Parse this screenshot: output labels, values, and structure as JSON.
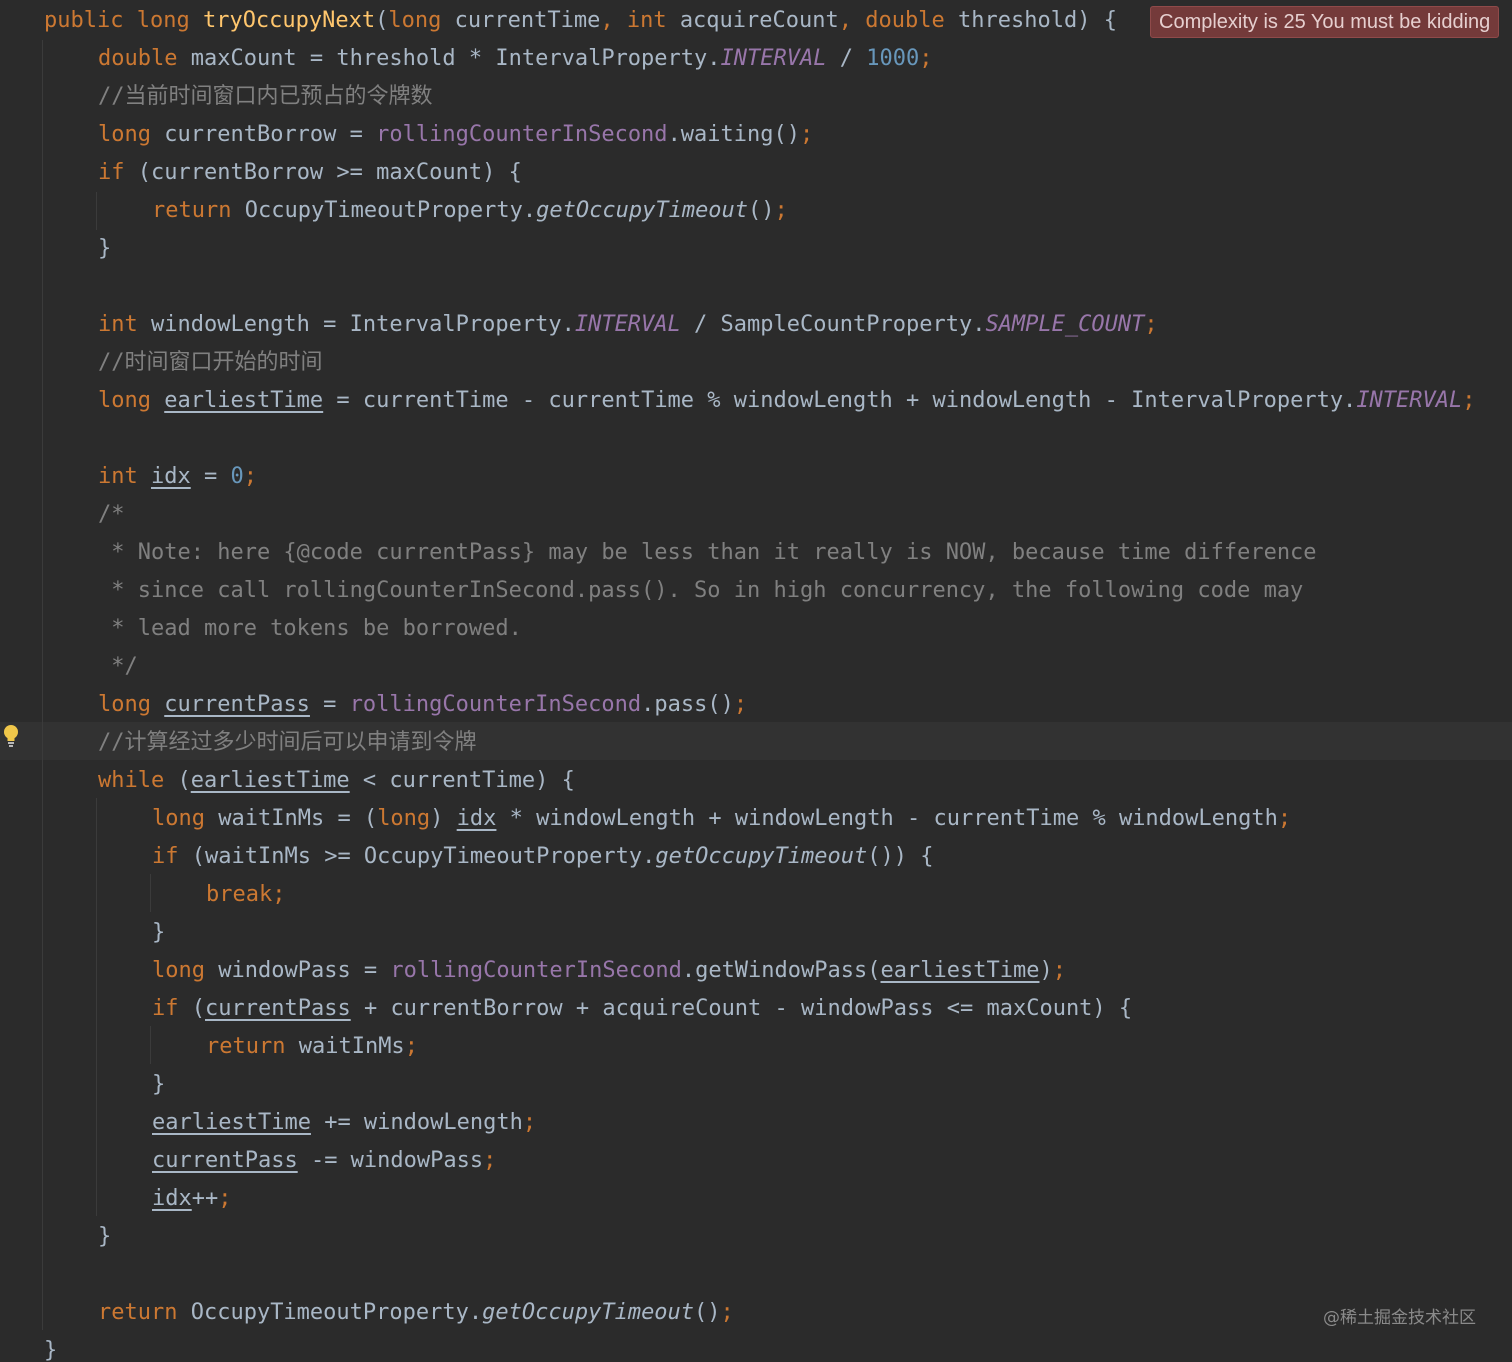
{
  "editor": {
    "complexity_badge": "Complexity is 25 You must be kidding",
    "watermark": "@稀土掘金技术社区",
    "lines": [
      [
        [
          "kw",
          "public "
        ],
        [
          "kw",
          "long "
        ],
        [
          "fn",
          "tryOccupyNext"
        ],
        [
          "op",
          "("
        ],
        [
          "kw",
          "long "
        ],
        [
          "id",
          "currentTime"
        ],
        [
          "pu",
          ", "
        ],
        [
          "kw",
          "int "
        ],
        [
          "id",
          "acquireCount"
        ],
        [
          "pu",
          ", "
        ],
        [
          "kw",
          "double "
        ],
        [
          "id",
          "threshold"
        ],
        [
          "op",
          ") {"
        ]
      ],
      [
        [
          "kw",
          "double "
        ],
        [
          "id",
          "maxCount = threshold * IntervalProperty."
        ],
        [
          "fldi",
          "INTERVAL"
        ],
        [
          "op",
          " / "
        ],
        [
          "num",
          "1000"
        ],
        [
          "pu",
          ";"
        ]
      ],
      [
        [
          "cmt",
          "//当前时间窗口内已预占的令牌数"
        ]
      ],
      [
        [
          "kw",
          "long "
        ],
        [
          "id",
          "currentBorrow = "
        ],
        [
          "fld",
          "rollingCounterInSecond"
        ],
        [
          "id",
          ".waiting()"
        ],
        [
          "pu",
          ";"
        ]
      ],
      [
        [
          "kw",
          "if "
        ],
        [
          "id",
          "(currentBorrow >= maxCount) {"
        ]
      ],
      [
        [
          "kw",
          "return "
        ],
        [
          "id",
          "OccupyTimeoutProperty."
        ],
        [
          "mi",
          "getOccupyTimeout"
        ],
        [
          "id",
          "()"
        ],
        [
          "pu",
          ";"
        ]
      ],
      [
        [
          "id",
          "}"
        ]
      ],
      [],
      [
        [
          "kw",
          "int "
        ],
        [
          "id",
          "windowLength = IntervalProperty."
        ],
        [
          "fldi",
          "INTERVAL"
        ],
        [
          "id",
          " / SampleCountProperty."
        ],
        [
          "fldi",
          "SAMPLE_COUNT"
        ],
        [
          "pu",
          ";"
        ]
      ],
      [
        [
          "cmt",
          "//时间窗口开始的时间"
        ]
      ],
      [
        [
          "kw",
          "long "
        ],
        [
          "ul",
          "earliestTime"
        ],
        [
          "id",
          " = currentTime - currentTime % windowLength + windowLength - IntervalProperty."
        ],
        [
          "fldi",
          "INTERVAL"
        ],
        [
          "pu",
          ";"
        ]
      ],
      [],
      [
        [
          "kw",
          "int "
        ],
        [
          "ul",
          "idx"
        ],
        [
          "id",
          " = "
        ],
        [
          "num",
          "0"
        ],
        [
          "pu",
          ";"
        ]
      ],
      [
        [
          "cmt",
          "/*"
        ]
      ],
      [
        [
          "cmt",
          " * Note: here {@code currentPass} may be less than it really is NOW, because time difference"
        ]
      ],
      [
        [
          "cmt",
          " * since call rollingCounterInSecond.pass(). So in high concurrency, the following code may"
        ]
      ],
      [
        [
          "cmt",
          " * lead more tokens be borrowed."
        ]
      ],
      [
        [
          "cmt",
          " */"
        ]
      ],
      [
        [
          "kw",
          "long "
        ],
        [
          "ul",
          "currentPass"
        ],
        [
          "id",
          " = "
        ],
        [
          "fld",
          "rollingCounterInSecond"
        ],
        [
          "id",
          ".pass()"
        ],
        [
          "pu",
          ";"
        ]
      ],
      [
        [
          "cmt",
          "//计算经过多少时间后可以申请到令牌"
        ]
      ],
      [
        [
          "kw",
          "while "
        ],
        [
          "id",
          "("
        ],
        [
          "ul",
          "earliestTime"
        ],
        [
          "id",
          " < currentTime) {"
        ]
      ],
      [
        [
          "kw",
          "long "
        ],
        [
          "id",
          "waitInMs = ("
        ],
        [
          "kw",
          "long"
        ],
        [
          "id",
          ") "
        ],
        [
          "ul",
          "idx"
        ],
        [
          "id",
          " * windowLength + windowLength - currentTime % windowLength"
        ],
        [
          "pu",
          ";"
        ]
      ],
      [
        [
          "kw",
          "if "
        ],
        [
          "id",
          "(waitInMs >= OccupyTimeoutProperty."
        ],
        [
          "mi",
          "getOccupyTimeout"
        ],
        [
          "id",
          "()) {"
        ]
      ],
      [
        [
          "kw",
          "break"
        ],
        [
          "pu",
          ";"
        ]
      ],
      [
        [
          "id",
          "}"
        ]
      ],
      [
        [
          "kw",
          "long "
        ],
        [
          "id",
          "windowPass = "
        ],
        [
          "fld",
          "rollingCounterInSecond"
        ],
        [
          "id",
          ".getWindowPass("
        ],
        [
          "ul",
          "earliestTime"
        ],
        [
          "id",
          ")"
        ],
        [
          "pu",
          ";"
        ]
      ],
      [
        [
          "kw",
          "if "
        ],
        [
          "id",
          "("
        ],
        [
          "ul",
          "currentPass"
        ],
        [
          "id",
          " + currentBorrow + acquireCount - windowPass <= maxCount) {"
        ]
      ],
      [
        [
          "kw",
          "return "
        ],
        [
          "id",
          "waitInMs"
        ],
        [
          "pu",
          ";"
        ]
      ],
      [
        [
          "id",
          "}"
        ]
      ],
      [
        [
          "ul",
          "earliestTime"
        ],
        [
          "id",
          " += windowLength"
        ],
        [
          "pu",
          ";"
        ]
      ],
      [
        [
          "ul",
          "currentPass"
        ],
        [
          "id",
          " -= windowPass"
        ],
        [
          "pu",
          ";"
        ]
      ],
      [
        [
          "ul",
          "idx"
        ],
        [
          "id",
          "++"
        ],
        [
          "pu",
          ";"
        ]
      ],
      [
        [
          "id",
          "}"
        ]
      ],
      [],
      [
        [
          "kw",
          "return "
        ],
        [
          "id",
          "OccupyTimeoutProperty."
        ],
        [
          "mi",
          "getOccupyTimeout"
        ],
        [
          "id",
          "()"
        ],
        [
          "pu",
          ";"
        ]
      ],
      [
        [
          "id",
          "}"
        ]
      ]
    ]
  }
}
